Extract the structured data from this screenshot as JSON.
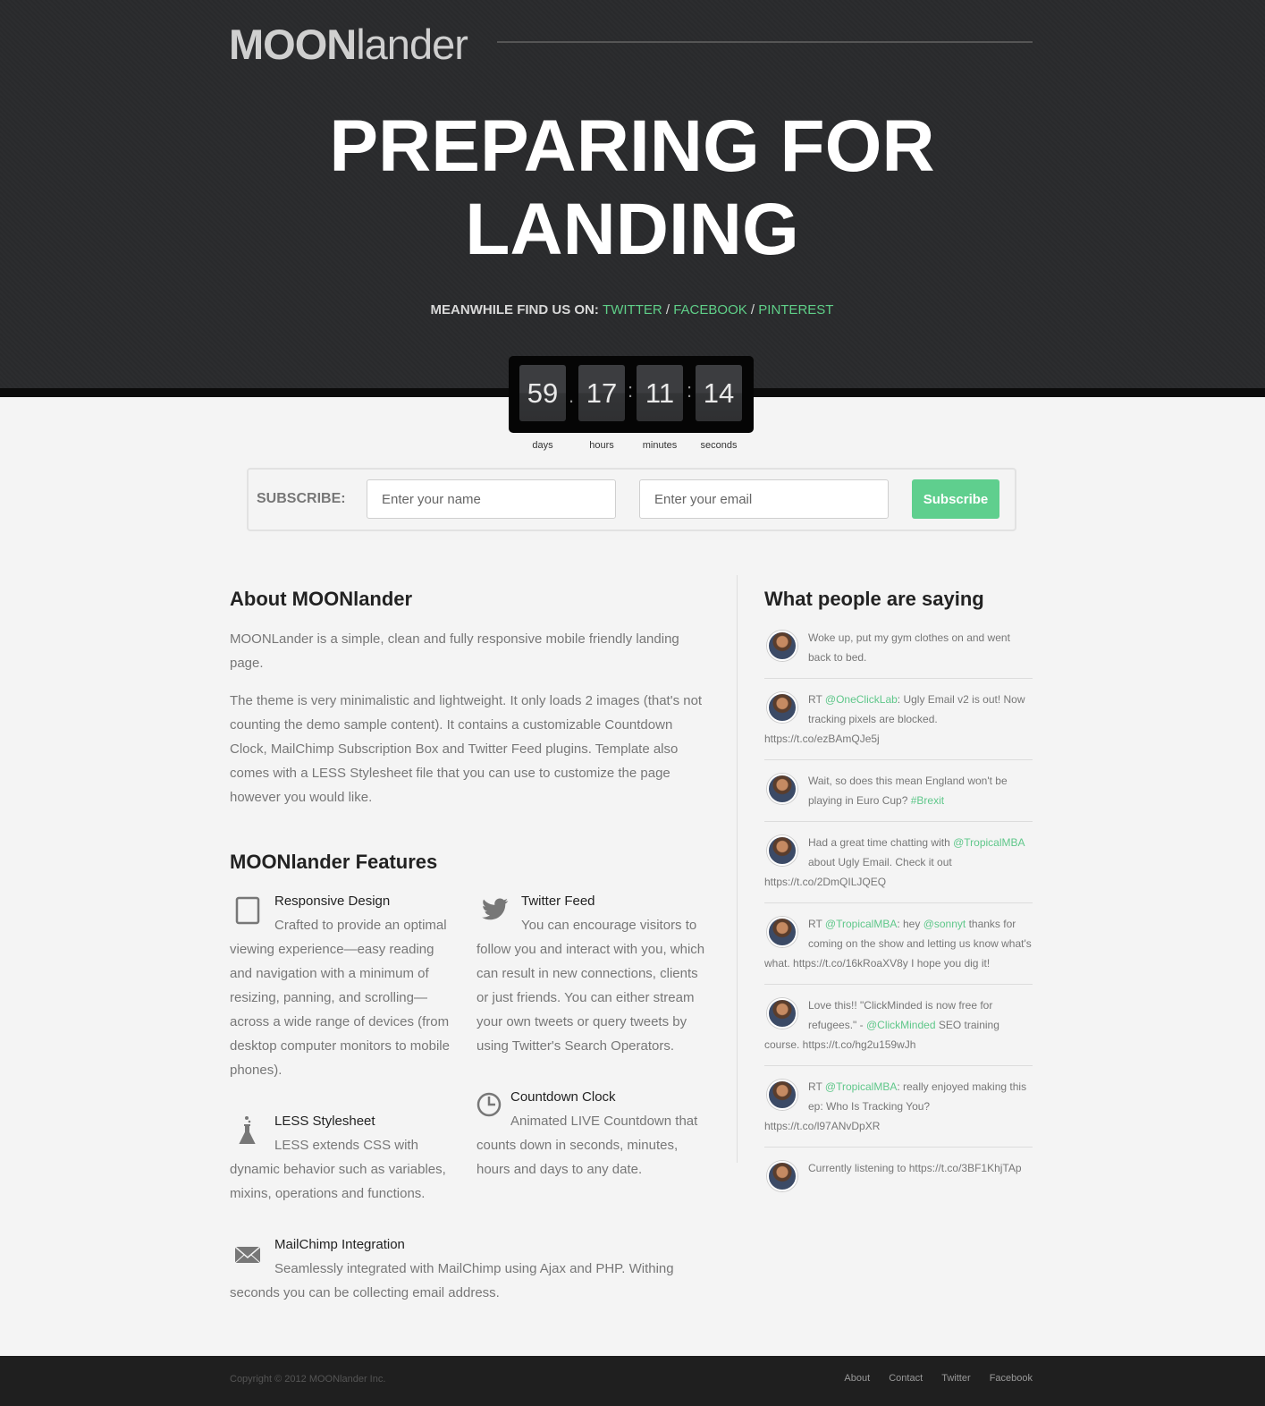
{
  "header": {
    "logo_bold": "MOON",
    "logo_light": "lander",
    "headline": "PREPARING FOR LANDING",
    "find_us_label": "MEANWHILE FIND US ON:",
    "social_links": [
      "TWITTER",
      "FACEBOOK",
      "PINTEREST"
    ]
  },
  "countdown": {
    "days": "59",
    "hours": "17",
    "minutes": "11",
    "seconds": "14",
    "labels": {
      "days": "days",
      "hours": "hours",
      "minutes": "minutes",
      "seconds": "seconds"
    }
  },
  "subscribe": {
    "label": "SUBSCRIBE:",
    "name_placeholder": "Enter your name",
    "email_placeholder": "Enter your email",
    "button": "Subscribe"
  },
  "about": {
    "title": "About MOONlander",
    "paragraphs": [
      "MOONLander is a simple, clean and fully responsive mobile friendly landing page.",
      "The theme is very minimalistic and lightweight. It only loads 2 images (that's not counting the demo sample content). It contains a customizable Countdown Clock, MailChimp Subscription Box and Twitter Feed plugins. Template also comes with a LESS Stylesheet file that you can use to customize the page however you would like."
    ]
  },
  "features": {
    "title": "MOONlander Features",
    "items": [
      {
        "icon": "tablet-icon",
        "title": "Responsive Design",
        "desc": "Crafted to provide an optimal viewing experience—easy reading and navigation with a minimum of resizing, panning, and scrolling—across a wide range of devices (from desktop computer monitors to mobile phones)."
      },
      {
        "icon": "twitter-bird-icon",
        "title": "Twitter Feed",
        "desc": "You can encourage visitors to follow you and interact with you, which can result in new connections, clients or just friends. You can either stream your own tweets or query tweets by using Twitter's Search Operators."
      },
      {
        "icon": "flask-icon",
        "title": "LESS Stylesheet",
        "desc": "LESS extends CSS with dynamic behavior such as variables, mixins, operations and functions."
      },
      {
        "icon": "clock-icon",
        "title": "Countdown Clock",
        "desc": "Animated LIVE Countdown that counts down in seconds, minutes, hours and days to any date."
      },
      {
        "icon": "envelope-icon",
        "title": "MailChimp Integration",
        "desc": "Seamlessly integrated with MailChimp using Ajax and PHP. Withing seconds you can be collecting email address."
      }
    ]
  },
  "tweets": {
    "title": "What people are saying",
    "items": [
      {
        "parts": [
          [
            "t",
            "Woke up, put my gym clothes on and went back to bed."
          ]
        ]
      },
      {
        "parts": [
          [
            "t",
            "RT "
          ],
          [
            "g",
            "@OneClickLab"
          ],
          [
            "t",
            ": Ugly Email v2 is out! Now tracking pixels are blocked. https://t.co/ezBAmQJe5j"
          ]
        ]
      },
      {
        "parts": [
          [
            "t",
            "Wait, so does this mean England won't be playing in Euro Cup? "
          ],
          [
            "g",
            "#Brexit"
          ]
        ]
      },
      {
        "parts": [
          [
            "t",
            "Had a great time chatting with "
          ],
          [
            "g",
            "@TropicalMBA"
          ],
          [
            "t",
            " about Ugly Email. Check it out https://t.co/2DmQILJQEQ"
          ]
        ]
      },
      {
        "parts": [
          [
            "t",
            "RT "
          ],
          [
            "g",
            "@TropicalMBA"
          ],
          [
            "t",
            ": hey "
          ],
          [
            "g",
            "@sonnyt"
          ],
          [
            "t",
            " thanks for coming on the show and letting us know what's what. https://t.co/16kRoaXV8y I hope you dig it!"
          ]
        ]
      },
      {
        "parts": [
          [
            "t",
            "Love this!! \"ClickMinded is now free for refugees.\" - "
          ],
          [
            "g",
            "@ClickMinded"
          ],
          [
            "t",
            " SEO training course. https://t.co/hg2u159wJh"
          ]
        ]
      },
      {
        "parts": [
          [
            "t",
            "RT "
          ],
          [
            "g",
            "@TropicalMBA"
          ],
          [
            "t",
            ": really enjoyed making this ep: Who Is Tracking You? https://t.co/l97ANvDpXR"
          ]
        ]
      },
      {
        "parts": [
          [
            "t",
            "Currently listening to https://t.co/3BF1KhjTAp"
          ]
        ]
      }
    ]
  },
  "footer": {
    "copyright": "Copyright © 2012 MOONlander Inc.",
    "links": [
      "About",
      "Contact",
      "Twitter",
      "Facebook"
    ]
  },
  "colors": {
    "accent": "#5fcf8e",
    "hero_bg": "#2a2b2d",
    "footer_bg": "#1f1f1f"
  }
}
